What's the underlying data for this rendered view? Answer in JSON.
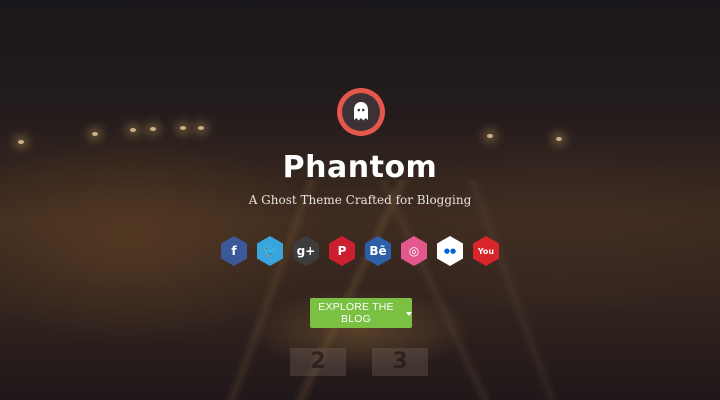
{
  "site": {
    "title": "Phantom",
    "tagline": "A Ghost Theme Crafted for Blogging",
    "logo_icon": "ghost-icon"
  },
  "social_links": [
    {
      "name": "facebook",
      "glyph": "f",
      "color": "#3b5998",
      "text_color": "#ffffff"
    },
    {
      "name": "twitter",
      "glyph": "🐦",
      "color": "#3aa5dc",
      "text_color": "#ffffff"
    },
    {
      "name": "google-plus",
      "glyph": "g+",
      "color": "#3d3d3d",
      "text_color": "#ffffff"
    },
    {
      "name": "pinterest",
      "glyph": "P",
      "color": "#cc2030",
      "text_color": "#ffffff"
    },
    {
      "name": "behance",
      "glyph": "Bē",
      "color": "#2d5fa8",
      "text_color": "#ffffff"
    },
    {
      "name": "dribbble",
      "glyph": "◎",
      "color": "#e2588c",
      "text_color": "#ffffff"
    },
    {
      "name": "flickr",
      "glyph": "●●",
      "color": "#ffffff",
      "text_color": "#0063dc"
    },
    {
      "name": "youtube",
      "glyph": "You",
      "color": "#d8252a",
      "text_color": "#ffffff"
    }
  ],
  "cta": {
    "label": "EXPLORE THE BLOG",
    "color": "#7ac143"
  },
  "background": {
    "platform_signs": [
      "2",
      "3"
    ]
  }
}
